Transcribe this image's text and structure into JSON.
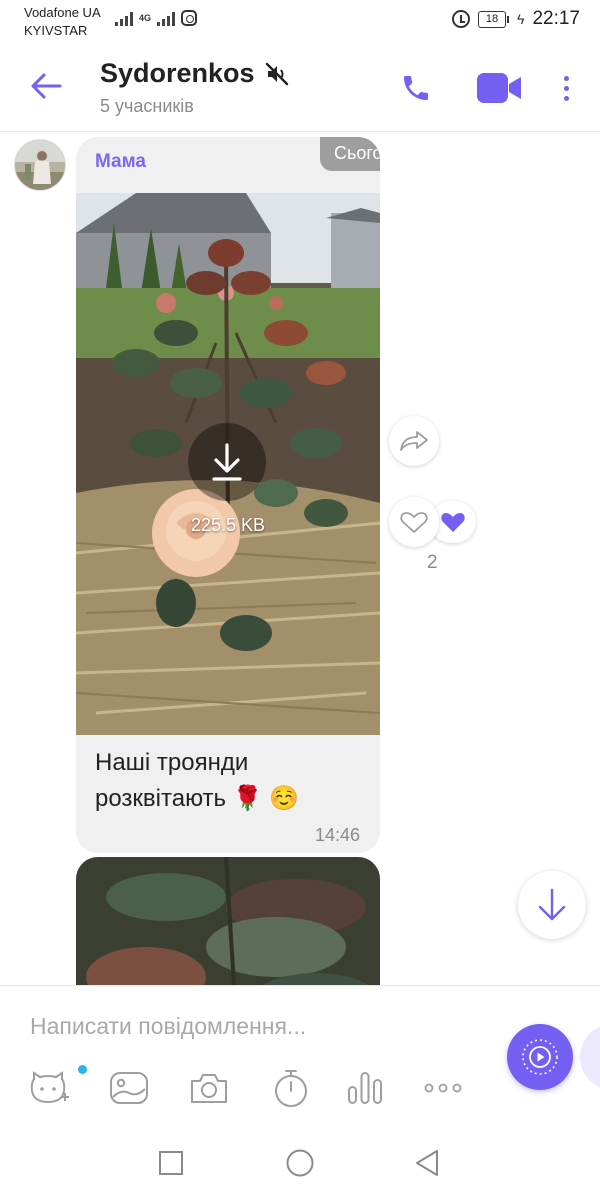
{
  "status_bar": {
    "carrier_line1": "Vodafone UA",
    "carrier_line2": "KYIVSTAR",
    "network": "4G",
    "battery": "18",
    "time": "22:17"
  },
  "header": {
    "title": "Sydorenkos",
    "subtitle": "5 учасників",
    "muted_icon": "muted-speaker-icon",
    "accent_color": "#7360f2"
  },
  "chat": {
    "date_label": "Сьогодні",
    "messages": [
      {
        "sender": "Мама",
        "attachment_size": "225.5 KB",
        "text": "Наші троянди розквітають 🌹 ☺️",
        "time": "14:46",
        "reactions": {
          "count": "2",
          "reaction_icon": "heart-icon"
        }
      }
    ]
  },
  "composer": {
    "placeholder": "Написати повідомлення...",
    "tools": [
      "sticker-icon",
      "gallery-icon",
      "camera-icon",
      "timer-icon",
      "poll-icon",
      "more-dots-icon"
    ]
  },
  "navbar": {
    "buttons": [
      "recents-square-icon",
      "home-circle-icon",
      "back-triangle-icon"
    ]
  }
}
